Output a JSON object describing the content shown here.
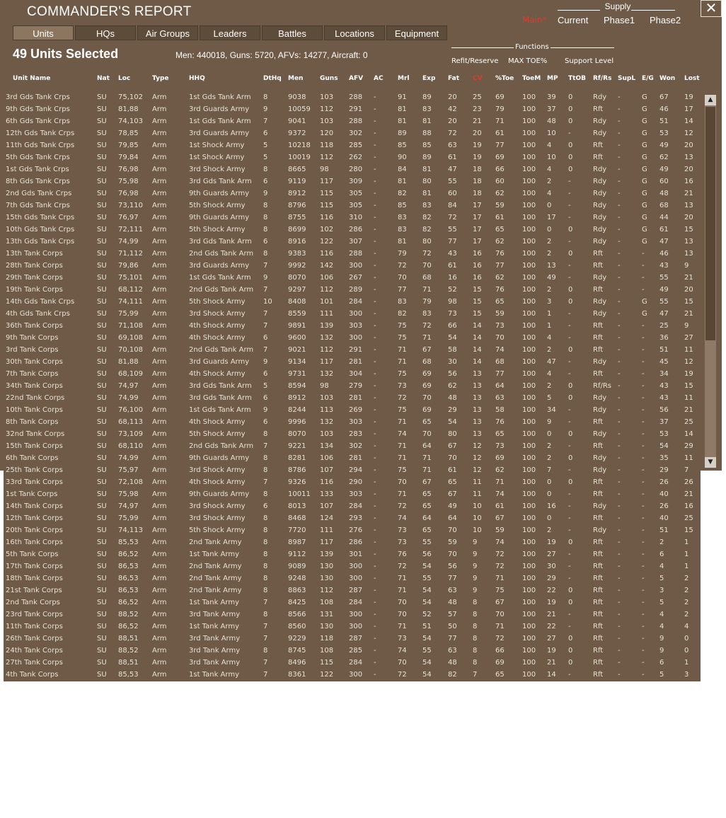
{
  "window": {
    "title": "COMMANDER'S REPORT",
    "close_icon": "close-icon"
  },
  "supply": {
    "label": "Supply",
    "main": "Main*",
    "options": [
      "Current",
      "Phase1",
      "Phase2"
    ]
  },
  "tabs": [
    "Units",
    "HQs",
    "Air Groups",
    "Leaders",
    "Battles",
    "Locations",
    "Equipment"
  ],
  "active_tab": "Units",
  "selection": {
    "title": "49 Units Selected",
    "summary": "Men: 440018, Guns: 5720, AFVs: 14277, Aircraft: 0"
  },
  "functions": {
    "label": "Functions",
    "options": [
      "Refit/Reserve",
      "MAX TOE%",
      "Support Level"
    ]
  },
  "columns": [
    "Unit Name",
    "Nat",
    "Loc",
    "Type",
    "HHQ",
    "DtHq",
    "Men",
    "Guns",
    "AFV",
    "AC",
    "Mrl",
    "Exp",
    "Fat",
    "CV",
    "%Toe",
    "ToeM",
    "MP",
    "TtOB",
    "Rf/Rs",
    "SupL",
    "E/G",
    "Won",
    "Lost"
  ],
  "highlight_column": "CV",
  "rows": [
    [
      "3rd Gds Tank Crps",
      "SU",
      "75,102",
      "Arm",
      "1st Gds Tank Arm",
      "8",
      "9038",
      "103",
      "288",
      "-",
      "91",
      "89",
      "20",
      "25",
      "69",
      "100",
      "39",
      "0",
      "Rdy",
      "-",
      "G",
      "67",
      "19"
    ],
    [
      "9th Gds Tank Crps",
      "SU",
      "81,88",
      "Arm",
      "3rd Guards Army",
      "9",
      "10059",
      "112",
      "291",
      "-",
      "81",
      "83",
      "42",
      "23",
      "79",
      "100",
      "37",
      "0",
      "Rft",
      "-",
      "G",
      "46",
      "17"
    ],
    [
      "6th Gds Tank Crps",
      "SU",
      "74,103",
      "Arm",
      "1st Gds Tank Arm",
      "7",
      "9041",
      "103",
      "288",
      "-",
      "81",
      "81",
      "20",
      "21",
      "71",
      "100",
      "48",
      "0",
      "Rdy",
      "-",
      "G",
      "51",
      "14"
    ],
    [
      "12th Gds Tank Crps",
      "SU",
      "78,85",
      "Arm",
      "3rd Guards Army",
      "6",
      "9372",
      "120",
      "302",
      "-",
      "89",
      "88",
      "72",
      "20",
      "61",
      "100",
      "10",
      "-",
      "Rdy",
      "-",
      "G",
      "53",
      "12"
    ],
    [
      "11th Gds Tank Crps",
      "SU",
      "79,85",
      "Arm",
      "1st Shock Army",
      "5",
      "10218",
      "118",
      "285",
      "-",
      "85",
      "85",
      "63",
      "19",
      "77",
      "100",
      "4",
      "0",
      "Rft",
      "-",
      "G",
      "49",
      "20"
    ],
    [
      "5th Gds Tank Crps",
      "SU",
      "79,84",
      "Arm",
      "1st Shock Army",
      "5",
      "10019",
      "112",
      "262",
      "-",
      "90",
      "89",
      "61",
      "19",
      "69",
      "100",
      "10",
      "0",
      "Rft",
      "-",
      "G",
      "62",
      "13"
    ],
    [
      "1st Gds Tank Crps",
      "SU",
      "76,98",
      "Arm",
      "3rd Shock Army",
      "8",
      "8665",
      "98",
      "280",
      "-",
      "84",
      "81",
      "47",
      "18",
      "66",
      "100",
      "4",
      "0",
      "Rdy",
      "-",
      "G",
      "49",
      "20"
    ],
    [
      "8th Gds Tank Crps",
      "SU",
      "75,98",
      "Arm",
      "3rd Gds Tank Arm",
      "6",
      "9119",
      "117",
      "309",
      "-",
      "81",
      "80",
      "55",
      "18",
      "60",
      "100",
      "2",
      "-",
      "Rdy",
      "-",
      "G",
      "60",
      "16"
    ],
    [
      "2nd Gds Tank Crps",
      "SU",
      "76,98",
      "Arm",
      "9th Guards Army",
      "9",
      "8912",
      "115",
      "305",
      "-",
      "82",
      "81",
      "60",
      "18",
      "62",
      "100",
      "4",
      "-",
      "Rdy",
      "-",
      "G",
      "48",
      "21"
    ],
    [
      "7th Gds Tank Crps",
      "SU",
      "73,110",
      "Arm",
      "5th Shock Army",
      "8",
      "8796",
      "115",
      "305",
      "-",
      "85",
      "83",
      "84",
      "17",
      "59",
      "100",
      "0",
      "-",
      "Rdy",
      "-",
      "G",
      "68",
      "13"
    ],
    [
      "15th Gds Tank Crps",
      "SU",
      "76,97",
      "Arm",
      "9th Guards Army",
      "8",
      "8755",
      "116",
      "310",
      "-",
      "83",
      "82",
      "72",
      "17",
      "61",
      "100",
      "17",
      "-",
      "Rdy",
      "-",
      "G",
      "44",
      "20"
    ],
    [
      "10th Gds Tank Crps",
      "SU",
      "72,111",
      "Arm",
      "5th Shock Army",
      "8",
      "8699",
      "102",
      "286",
      "-",
      "83",
      "82",
      "55",
      "17",
      "65",
      "100",
      "0",
      "0",
      "Rdy",
      "-",
      "G",
      "61",
      "15"
    ],
    [
      "13th Gds Tank Crps",
      "SU",
      "74,99",
      "Arm",
      "3rd Gds Tank Arm",
      "6",
      "8916",
      "122",
      "307",
      "-",
      "81",
      "80",
      "77",
      "17",
      "62",
      "100",
      "2",
      "-",
      "Rdy",
      "-",
      "G",
      "47",
      "13"
    ],
    [
      "13th Tank Corps",
      "SU",
      "71,112",
      "Arm",
      "2nd Gds Tank Arm",
      "8",
      "9383",
      "116",
      "288",
      "-",
      "79",
      "72",
      "43",
      "16",
      "76",
      "100",
      "2",
      "0",
      "Rft",
      "-",
      "-",
      "46",
      "13"
    ],
    [
      "28th Tank Corps",
      "SU",
      "79,86",
      "Arm",
      "3rd Guards Army",
      "7",
      "9992",
      "142",
      "300",
      "-",
      "72",
      "70",
      "61",
      "16",
      "77",
      "100",
      "13",
      "-",
      "Rft",
      "-",
      "-",
      "43",
      "9"
    ],
    [
      "29th Tank Corps",
      "SU",
      "75,101",
      "Arm",
      "1st Gds Tank Arm",
      "9",
      "8070",
      "106",
      "267",
      "-",
      "70",
      "68",
      "16",
      "16",
      "62",
      "100",
      "49",
      "-",
      "Rdy",
      "-",
      "-",
      "55",
      "21"
    ],
    [
      "19th Tank Corps",
      "SU",
      "68,112",
      "Arm",
      "2nd Gds Tank Arm",
      "7",
      "9297",
      "112",
      "289",
      "-",
      "77",
      "71",
      "52",
      "15",
      "76",
      "100",
      "2",
      "0",
      "Rft",
      "-",
      "-",
      "49",
      "20"
    ],
    [
      "14th Gds Tank Crps",
      "SU",
      "74,111",
      "Arm",
      "5th Shock Army",
      "10",
      "8408",
      "101",
      "284",
      "-",
      "83",
      "79",
      "98",
      "15",
      "65",
      "100",
      "3",
      "0",
      "Rdy",
      "-",
      "G",
      "55",
      "15"
    ],
    [
      "4th Gds Tank Crps",
      "SU",
      "75,99",
      "Arm",
      "3rd Shock Army",
      "7",
      "8559",
      "111",
      "300",
      "-",
      "82",
      "83",
      "73",
      "15",
      "59",
      "100",
      "1",
      "-",
      "Rdy",
      "-",
      "G",
      "47",
      "21"
    ],
    [
      "36th Tank Corps",
      "SU",
      "71,108",
      "Arm",
      "4th Shock Army",
      "7",
      "9891",
      "139",
      "303",
      "-",
      "75",
      "72",
      "66",
      "14",
      "73",
      "100",
      "1",
      "-",
      "Rft",
      "-",
      "-",
      "25",
      "9"
    ],
    [
      "9th Tank Corps",
      "SU",
      "69,108",
      "Arm",
      "4th Shock Army",
      "6",
      "9600",
      "132",
      "300",
      "-",
      "75",
      "71",
      "54",
      "14",
      "70",
      "100",
      "4",
      "-",
      "Rft",
      "-",
      "-",
      "36",
      "27"
    ],
    [
      "3rd Tank Corps",
      "SU",
      "70,108",
      "Arm",
      "2nd Gds Tank Arm",
      "7",
      "9021",
      "112",
      "291",
      "-",
      "71",
      "67",
      "58",
      "14",
      "74",
      "100",
      "2",
      "0",
      "Rft",
      "-",
      "-",
      "51",
      "11"
    ],
    [
      "30th Tank Corps",
      "SU",
      "81,88",
      "Arm",
      "3rd Guards Army",
      "9",
      "9134",
      "117",
      "281",
      "-",
      "71",
      "68",
      "30",
      "14",
      "68",
      "100",
      "47",
      "-",
      "Rdy",
      "-",
      "-",
      "45",
      "12"
    ],
    [
      "7th Tank Corps",
      "SU",
      "68,109",
      "Arm",
      "4th Shock Army",
      "6",
      "9731",
      "132",
      "304",
      "-",
      "75",
      "69",
      "56",
      "13",
      "77",
      "100",
      "4",
      "-",
      "Rft",
      "-",
      "-",
      "34",
      "19"
    ],
    [
      "34th Tank Corps",
      "SU",
      "74,97",
      "Arm",
      "3rd Gds Tank Arm",
      "5",
      "8594",
      "98",
      "279",
      "-",
      "73",
      "69",
      "62",
      "13",
      "64",
      "100",
      "2",
      "0",
      "Rf/Rs",
      "-",
      "-",
      "43",
      "15"
    ],
    [
      "22nd Tank Corps",
      "SU",
      "74,99",
      "Arm",
      "3rd Gds Tank Arm",
      "6",
      "8912",
      "103",
      "281",
      "-",
      "72",
      "70",
      "48",
      "13",
      "63",
      "100",
      "5",
      "0",
      "Rdy",
      "-",
      "-",
      "43",
      "11"
    ],
    [
      "10th Tank Corps",
      "SU",
      "76,100",
      "Arm",
      "1st Gds Tank Arm",
      "9",
      "8244",
      "113",
      "269",
      "-",
      "75",
      "69",
      "29",
      "13",
      "58",
      "100",
      "34",
      "-",
      "Rdy",
      "-",
      "-",
      "56",
      "21"
    ],
    [
      "8th Tank Corps",
      "SU",
      "68,113",
      "Arm",
      "4th Shock Army",
      "6",
      "9996",
      "132",
      "303",
      "-",
      "71",
      "65",
      "54",
      "13",
      "76",
      "100",
      "9",
      "-",
      "Rft",
      "-",
      "-",
      "37",
      "25"
    ],
    [
      "32nd Tank Corps",
      "SU",
      "73,109",
      "Arm",
      "5th Shock Army",
      "8",
      "8070",
      "103",
      "283",
      "-",
      "74",
      "70",
      "80",
      "13",
      "65",
      "100",
      "0",
      "0",
      "Rdy",
      "-",
      "-",
      "53",
      "14"
    ],
    [
      "15th Tank Corps",
      "SU",
      "68,110",
      "Arm",
      "2nd Gds Tank Arm",
      "7",
      "9221",
      "134",
      "302",
      "-",
      "71",
      "64",
      "67",
      "12",
      "73",
      "100",
      "2",
      "-",
      "Rft",
      "-",
      "-",
      "54",
      "29"
    ],
    [
      "6th Tank Corps",
      "SU",
      "74,99",
      "Arm",
      "9th Guards Army",
      "8",
      "8281",
      "106",
      "281",
      "-",
      "71",
      "71",
      "70",
      "12",
      "69",
      "100",
      "2",
      "0",
      "Rdy",
      "-",
      "-",
      "35",
      "11"
    ],
    [
      "25th Tank Corps",
      "SU",
      "75,97",
      "Arm",
      "3rd Shock Army",
      "8",
      "8786",
      "107",
      "294",
      "-",
      "75",
      "71",
      "61",
      "12",
      "62",
      "100",
      "7",
      "-",
      "Rdy",
      "-",
      "-",
      "29",
      "7"
    ],
    [
      "33rd Tank Corps",
      "SU",
      "72,108",
      "Arm",
      "4th Shock Army",
      "7",
      "9326",
      "116",
      "290",
      "-",
      "70",
      "67",
      "65",
      "11",
      "71",
      "100",
      "0",
      "0",
      "Rft",
      "-",
      "-",
      "26",
      "26"
    ],
    [
      "1st Tank Corps",
      "SU",
      "75,98",
      "Arm",
      "9th Guards Army",
      "8",
      "10011",
      "133",
      "303",
      "-",
      "71",
      "65",
      "67",
      "11",
      "74",
      "100",
      "0",
      "-",
      "Rft",
      "-",
      "-",
      "40",
      "21"
    ],
    [
      "14th Tank Corps",
      "SU",
      "74,97",
      "Arm",
      "3rd Shock Army",
      "6",
      "8013",
      "107",
      "284",
      "-",
      "72",
      "65",
      "49",
      "10",
      "61",
      "100",
      "16",
      "-",
      "Rdy",
      "-",
      "-",
      "26",
      "16"
    ],
    [
      "12th Tank Corps",
      "SU",
      "75,99",
      "Arm",
      "3rd Shock Army",
      "8",
      "8468",
      "124",
      "293",
      "-",
      "74",
      "64",
      "64",
      "10",
      "67",
      "100",
      "0",
      "-",
      "Rft",
      "-",
      "-",
      "40",
      "25"
    ],
    [
      "20th Tank Corps",
      "SU",
      "74,113",
      "Arm",
      "5th Shock Army",
      "8",
      "7720",
      "111",
      "276",
      "-",
      "73",
      "65",
      "70",
      "10",
      "59",
      "100",
      "2",
      "-",
      "Rdy",
      "-",
      "-",
      "51",
      "15"
    ],
    [
      "16th Tank Corps",
      "SU",
      "85,53",
      "Arm",
      "2nd Tank Army",
      "8",
      "8987",
      "117",
      "286",
      "-",
      "73",
      "55",
      "59",
      "9",
      "74",
      "100",
      "19",
      "0",
      "Rft",
      "-",
      "-",
      "2",
      "1"
    ],
    [
      "5th Tank Corps",
      "SU",
      "86,52",
      "Arm",
      "1st Tank Army",
      "8",
      "9112",
      "139",
      "301",
      "-",
      "76",
      "56",
      "70",
      "9",
      "72",
      "100",
      "27",
      "-",
      "Rft",
      "-",
      "-",
      "6",
      "1"
    ],
    [
      "17th Tank Corps",
      "SU",
      "86,53",
      "Arm",
      "2nd Tank Army",
      "8",
      "9089",
      "130",
      "300",
      "-",
      "72",
      "54",
      "56",
      "9",
      "72",
      "100",
      "30",
      "-",
      "Rft",
      "-",
      "-",
      "4",
      "1"
    ],
    [
      "18th Tank Corps",
      "SU",
      "86,53",
      "Arm",
      "2nd Tank Army",
      "8",
      "9248",
      "130",
      "300",
      "-",
      "71",
      "55",
      "77",
      "9",
      "71",
      "100",
      "29",
      "-",
      "Rft",
      "-",
      "-",
      "5",
      "2"
    ],
    [
      "21st Tank Corps",
      "SU",
      "86,53",
      "Arm",
      "2nd Tank Army",
      "8",
      "8863",
      "112",
      "287",
      "-",
      "71",
      "54",
      "63",
      "9",
      "75",
      "100",
      "22",
      "0",
      "Rft",
      "-",
      "-",
      "3",
      "2"
    ],
    [
      "2nd Tank Corps",
      "SU",
      "86,52",
      "Arm",
      "1st Tank Army",
      "7",
      "8425",
      "108",
      "284",
      "-",
      "70",
      "54",
      "48",
      "8",
      "67",
      "100",
      "19",
      "0",
      "Rft",
      "-",
      "-",
      "5",
      "2"
    ],
    [
      "23rd Tank Corps",
      "SU",
      "88,52",
      "Arm",
      "3rd Tank Army",
      "8",
      "8566",
      "131",
      "300",
      "-",
      "70",
      "52",
      "57",
      "8",
      "70",
      "100",
      "21",
      "-",
      "Rft",
      "-",
      "-",
      "4",
      "2"
    ],
    [
      "11th Tank Corps",
      "SU",
      "86,52",
      "Arm",
      "1st Tank Army",
      "7",
      "8560",
      "130",
      "300",
      "-",
      "71",
      "51",
      "50",
      "8",
      "71",
      "100",
      "22",
      "-",
      "Rft",
      "-",
      "-",
      "4",
      "4"
    ],
    [
      "26th Tank Corps",
      "SU",
      "88,51",
      "Arm",
      "3rd Tank Army",
      "7",
      "9229",
      "118",
      "287",
      "-",
      "73",
      "54",
      "77",
      "8",
      "72",
      "100",
      "27",
      "0",
      "Rft",
      "-",
      "-",
      "9",
      "0"
    ],
    [
      "24th Tank Corps",
      "SU",
      "88,52",
      "Arm",
      "3rd Tank Army",
      "8",
      "8745",
      "108",
      "285",
      "-",
      "74",
      "55",
      "63",
      "8",
      "66",
      "100",
      "19",
      "0",
      "Rft",
      "-",
      "-",
      "9",
      "0"
    ],
    [
      "27th Tank Corps",
      "SU",
      "88,51",
      "Arm",
      "3rd Tank Army",
      "7",
      "8496",
      "115",
      "284",
      "-",
      "70",
      "54",
      "48",
      "8",
      "69",
      "100",
      "21",
      "0",
      "Rft",
      "-",
      "-",
      "6",
      "1"
    ],
    [
      "4th Tank Corps",
      "SU",
      "85,53",
      "Arm",
      "1st Tank Army",
      "7",
      "8361",
      "122",
      "300",
      "-",
      "72",
      "54",
      "82",
      "7",
      "65",
      "100",
      "14",
      "-",
      "Rft",
      "-",
      "-",
      "5",
      "3"
    ]
  ],
  "scrollbar": {
    "up_icon": "arrow-up-icon",
    "down_icon": "arrow-down-icon"
  }
}
